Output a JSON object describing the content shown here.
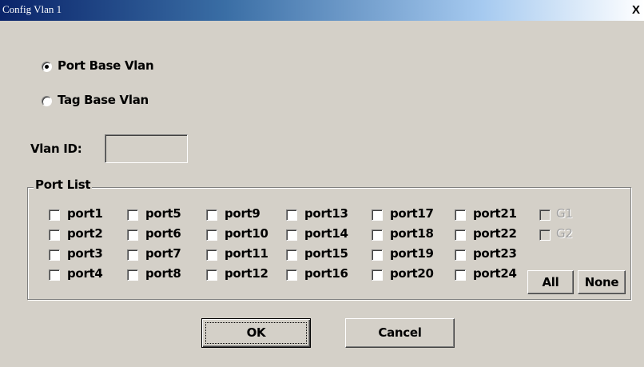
{
  "window": {
    "title": "Config Vlan 1",
    "close_label": "X"
  },
  "vlan_type": {
    "options": [
      {
        "label": "Port Base Vlan",
        "selected": true
      },
      {
        "label": "Tag Base Vlan",
        "selected": false
      }
    ]
  },
  "vlan_id": {
    "label": "Vlan ID:",
    "value": ""
  },
  "port_list": {
    "legend": "Port List",
    "columns": [
      [
        "port1",
        "port2",
        "port3",
        "port4"
      ],
      [
        "port5",
        "port6",
        "port7",
        "port8"
      ],
      [
        "port9",
        "port10",
        "port11",
        "port12"
      ],
      [
        "port13",
        "port14",
        "port15",
        "port16"
      ],
      [
        "port17",
        "port18",
        "port19",
        "port20"
      ],
      [
        "port21",
        "port22",
        "port23",
        "port24"
      ]
    ],
    "gigabit_ports": [
      {
        "label": "G1",
        "enabled": false,
        "checked": false
      },
      {
        "label": "G2",
        "enabled": false,
        "checked": false
      }
    ],
    "all_label": "All",
    "none_label": "None"
  },
  "actions": {
    "ok_label": "OK",
    "cancel_label": "Cancel"
  }
}
